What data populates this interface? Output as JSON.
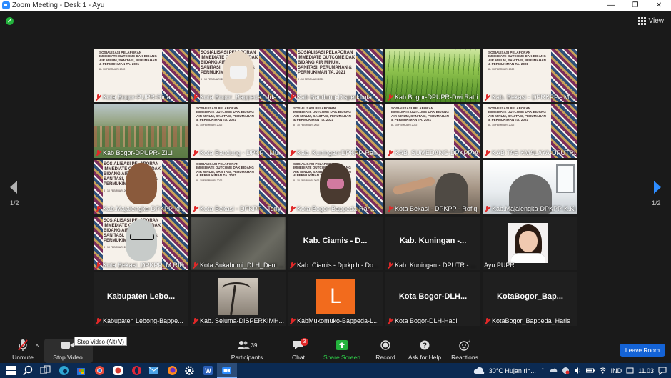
{
  "window": {
    "title": "Zoom Meeting - Desk 1 - Ayu",
    "controls": [
      "—",
      "❐",
      "✕"
    ]
  },
  "top": {
    "view_label": "View"
  },
  "pager": {
    "left_label": "1/2",
    "right_label": "1/2"
  },
  "tiles": [
    {
      "name": "Kota Bogor-PUPR-Rina",
      "kind": "slide"
    },
    {
      "name": "Kota Bogor_Bappeda_Uda...",
      "kind": "slide-hijab"
    },
    {
      "name": "Kab Bandung-Disperkimta...",
      "kind": "slide"
    },
    {
      "name": "Kab Bogor-DPUPR-Dwi Ratri",
      "kind": "grass"
    },
    {
      "name": "Kab. Bekasi - DPRKPP - Mu...",
      "kind": "slide"
    },
    {
      "name": "Kab Bogor-DPUPR- ZILI",
      "kind": "aerial"
    },
    {
      "name": "Kota Bandung - DPKP - Mu...",
      "kind": "slide"
    },
    {
      "name": "Kab. Kuningan-DPKPP-Rah...",
      "kind": "slide"
    },
    {
      "name": "KAB. SUMEDANG-DPKPP-A...",
      "kind": "slide"
    },
    {
      "name": "KAB.TAS KMALAYA-DPUTRL...",
      "kind": "slide"
    },
    {
      "name": "Kab.Majalengka-DPKPP-iq...",
      "kind": "slide-face"
    },
    {
      "name": "Kota Bekasi - DPKPP - Tony",
      "kind": "slide"
    },
    {
      "name": "Kota Bogor-Bappeda-Rah...",
      "kind": "slide-dark"
    },
    {
      "name": "Kota Bekasi - DPKPP - Rofiq...",
      "kind": "hands"
    },
    {
      "name": "Kab.Majalengka-DPKPP-K.Ki...",
      "kind": "room"
    },
    {
      "name": "Kota Bekasi_DPKPP_M.RID...",
      "kind": "slide-glasses"
    },
    {
      "name": "Kota Sukabumi_DLH_Deni ...",
      "kind": "blur"
    },
    {
      "name": "Kab. Ciamis - Dprkplh - Do...",
      "kind": "text",
      "big": "Kab. Ciamis - D..."
    },
    {
      "name": "Kab. Kuningan - DPUTR - ...",
      "kind": "text",
      "big": "Kab. Kuningan -..."
    },
    {
      "name": "Ayu PUPR",
      "kind": "avatar"
    },
    {
      "name": "Kabupaten Lebong-Bappe...",
      "kind": "text",
      "big": "Kabupaten Lebo..."
    },
    {
      "name": "Kab. Seluma-DISPERKIMH...",
      "kind": "palm"
    },
    {
      "name": "KabMukomuko-Bappeda-L...",
      "kind": "letter",
      "letter": "L"
    },
    {
      "name": "Kota Bogor-DLH-Hadi",
      "kind": "text",
      "big": "Kota Bogor-DLH..."
    },
    {
      "name": "KotaBogor_Bappeda_Haris",
      "kind": "text",
      "big": "KotaBogor_Bap..."
    }
  ],
  "slide_text": {
    "title": "SOSIALISASI PELAPORAN IMMEDIATE OUTCOME DAK BIDANG AIR MINUM, SANITASI, PERUMAHAN & PERMUKIMAN TA. 2021",
    "date": "8 - 10 Februari 2022"
  },
  "toolbar": {
    "unmute": "Unmute",
    "stop_video": "Stop Video",
    "stop_video_tooltip": "Stop Video (Alt+V)",
    "participants": "Participants",
    "participants_count": "39",
    "chat": "Chat",
    "chat_badge": "3",
    "share_screen": "Share Screen",
    "record": "Record",
    "ask_for_help": "Ask for Help",
    "reactions": "Reactions",
    "leave": "Leave Room"
  },
  "taskbar": {
    "weather": "30°C  Hujan rin...",
    "lang": "IND",
    "time": "11.03"
  },
  "colors": {
    "accent": "#2d8cff",
    "leave": "#1463d6",
    "share": "#23b33c",
    "muted": "#e02828"
  }
}
